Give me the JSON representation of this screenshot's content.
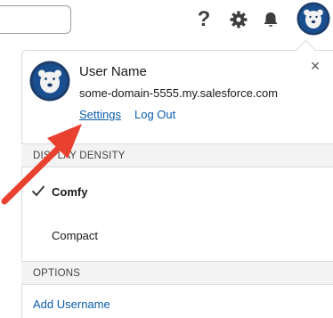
{
  "topbar": {
    "help_icon": "?",
    "icons": [
      "help-icon",
      "gear-icon",
      "bell-icon",
      "avatar-icon"
    ]
  },
  "profile_panel": {
    "user_name": "User Name",
    "domain": "some-domain-5555.my.salesforce.com",
    "settings_label": "Settings",
    "logout_label": "Log Out",
    "close_icon": "×"
  },
  "display_density": {
    "header": "DISPLAY DENSITY",
    "options": [
      "Comfy",
      "Compact"
    ],
    "selected": "Comfy"
  },
  "options": {
    "header": "OPTIONS",
    "add_username_label": "Add Username"
  },
  "colors": {
    "link": "#0b5cab",
    "annotation_arrow": "#e8412f",
    "avatar_bg": "#1d3d6b"
  }
}
